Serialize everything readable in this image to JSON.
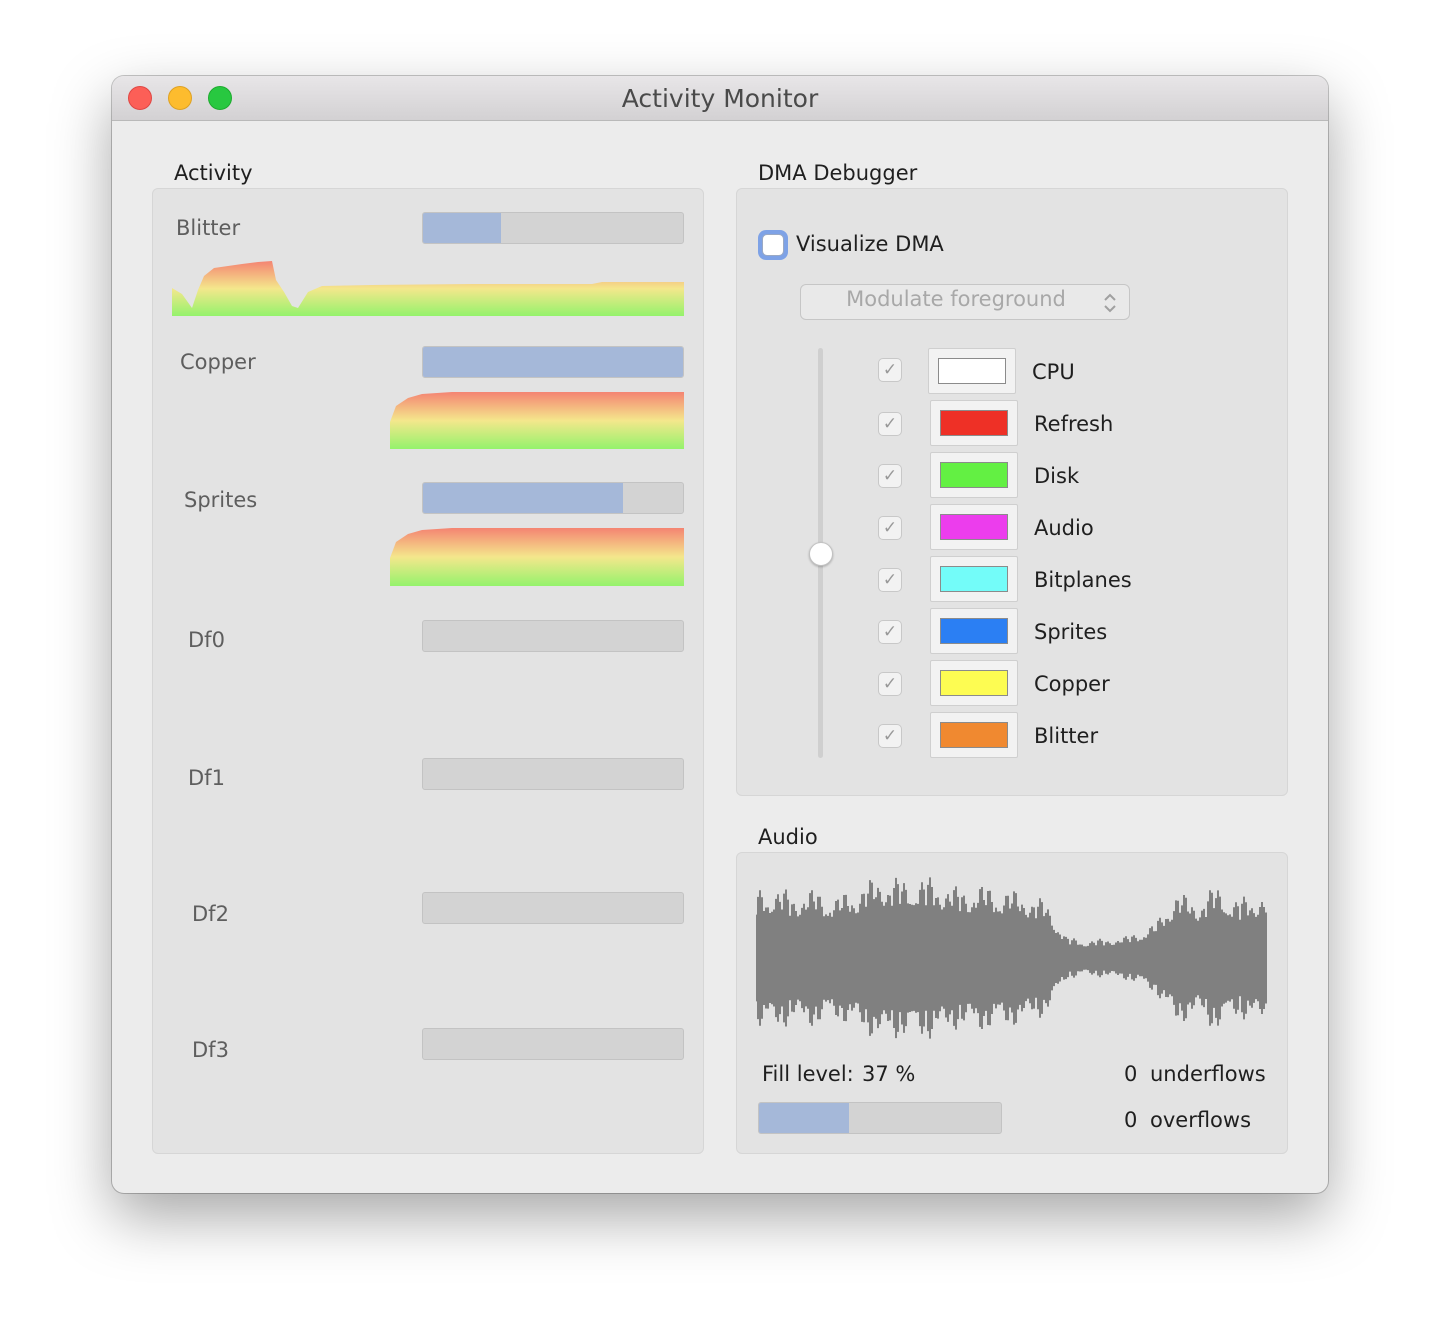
{
  "window": {
    "title": "Activity Monitor",
    "buttons": {
      "close": "close-button",
      "minimize": "minimize-button",
      "zoom": "zoom-button"
    }
  },
  "activity": {
    "title": "Activity",
    "channels": [
      {
        "label": "Blitter",
        "level": 0.3
      },
      {
        "label": "Copper",
        "level": 1.0
      },
      {
        "label": "Sprites",
        "level": 0.77
      },
      {
        "label": "Df0",
        "level": 0
      },
      {
        "label": "Df1",
        "level": 0
      },
      {
        "label": "Df2",
        "level": 0
      },
      {
        "label": "Df3",
        "level": 0
      }
    ]
  },
  "dma": {
    "title": "DMA Debugger",
    "visualize_label": "Visualize DMA",
    "visualize_checked": false,
    "mode_popup": "Modulate foreground",
    "opacity_slider_level": 0.5,
    "channels": [
      {
        "label": "CPU",
        "color": "#ffffff",
        "checked": true
      },
      {
        "label": "Refresh",
        "color": "#ee3026",
        "checked": true
      },
      {
        "label": "Disk",
        "color": "#63f043",
        "checked": true
      },
      {
        "label": "Audio",
        "color": "#ec3ded",
        "checked": true
      },
      {
        "label": "Bitplanes",
        "color": "#73fcf9",
        "checked": true
      },
      {
        "label": "Sprites",
        "color": "#2b7ff3",
        "checked": true
      },
      {
        "label": "Copper",
        "color": "#fdfc52",
        "checked": true
      },
      {
        "label": "Blitter",
        "color": "#f08930",
        "checked": true
      }
    ]
  },
  "audio": {
    "title": "Audio",
    "fill_label": "Fill level:",
    "fill_value": "37 %",
    "fill_level": 0.37,
    "underflows_count": "0",
    "underflows_label": "underflows",
    "overflows_count": "0",
    "overflows_label": "overflows"
  },
  "colors": {
    "bar_fill": "#a5b8d9",
    "graph_top": "#f48472",
    "graph_mid": "#f4e78c",
    "graph_bottom": "#94f26c",
    "waveform": "#808080"
  },
  "icons": {
    "checkmark": "checkmark-icon",
    "popup_arrows": "updown-chevron-icon"
  }
}
